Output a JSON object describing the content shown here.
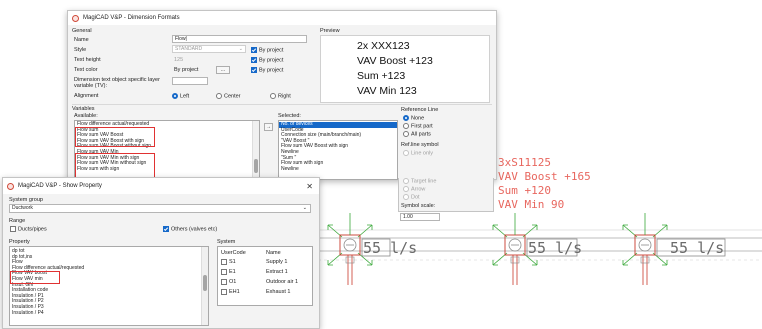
{
  "dimension_window": {
    "title": "MagiCAD V&P - Dimension Formats",
    "general_label": "General",
    "name_label": "Name",
    "name_value": "Flow|",
    "style_label": "Style",
    "style_value": "STANDARD",
    "text_height_label": "Text height",
    "text_height_value": "125",
    "text_color_label": "Text color",
    "text_color_value": "By project",
    "text_color_btn": "...",
    "layer_label": "Dimension text object specific layer variable (TV):",
    "alignment_label": "Alignment",
    "by_project": "By project",
    "align_left": "Left",
    "align_center": "Center",
    "align_right": "Right",
    "preview_label": "Preview",
    "preview_lines": [
      "2x XXX123",
      "VAV Boost +123",
      "Sum +123",
      "VAV Min 123"
    ],
    "variables_label": "Variables",
    "available_label": "Available:",
    "selected_label": "Selected:",
    "move_btn": "→",
    "available_items": [
      "Flow difference actual/requested",
      "Flow sum",
      "Flow sum VAV Boost",
      "Flow sum VAV Boost with sign",
      "Flow sum VAV Boost without sign",
      "Flow sum VAV Min",
      "Flow sum VAV Min with sign",
      "Flow sum VAV Min without sign",
      "Flow sum with sign"
    ],
    "selected_items": [
      "No. of devices",
      "UserCode",
      "Connection size (main/branch/main)",
      "\"VAV Boost \"",
      "Flow sum VAV Boost with sign",
      "Newline",
      "\"Sum \"",
      "Flow sum with sign",
      "Newline"
    ],
    "reference_line_label": "Reference Line",
    "ref_none": "None",
    "ref_first": "First part",
    "ref_all": "All parts",
    "ref_symbol_label": "Ref.line symbol",
    "sym_line": "Line only",
    "sym_target": "Target line",
    "sym_arrow": "Arrow",
    "sym_dot": "Dot",
    "symbol_scale_label": "Symbol scale:",
    "symbol_scale_value": "1.00"
  },
  "property_window": {
    "title": "MagiCAD V&P - Show Property",
    "close_icon": "✕",
    "system_group_label": "System group",
    "system_group_value": "Ductwork",
    "range_label": "Range",
    "ducts_label": "Ducts/pipes",
    "others_label": "Others (valves etc)",
    "property_label": "Property",
    "property_items": [
      "dp tot",
      "dp tot,ins",
      "Flow",
      "Flow difference actual/requested",
      "Flow VAV boost",
      "Flow VAV min",
      "Insul. GN",
      "Installation code",
      "Insulation / P1",
      "Insulation / P2",
      "Insulation / P3",
      "Insulation / P4"
    ],
    "system_label": "System",
    "usercode_header": "UserCode",
    "name_header": "Name",
    "system_rows": [
      {
        "code": "S1",
        "name": "Supply 1"
      },
      {
        "code": "E1",
        "name": "Extract 1"
      },
      {
        "code": "O1",
        "name": "Outdoor air 1"
      },
      {
        "code": "EH1",
        "name": "Exhaust 1"
      }
    ]
  },
  "cad": {
    "annotation_lines": [
      "3xS11125",
      "VAV Boost +165",
      "Sum +120",
      "VAV Min 90"
    ],
    "flow_labels": [
      "55 l/s",
      "55 l/s",
      "55 l/s"
    ],
    "annotation_color": "#e8675f",
    "green_color": "#3aa83a"
  },
  "colors": {
    "accent": "#1669c9",
    "highlight_box": "#e03232"
  }
}
